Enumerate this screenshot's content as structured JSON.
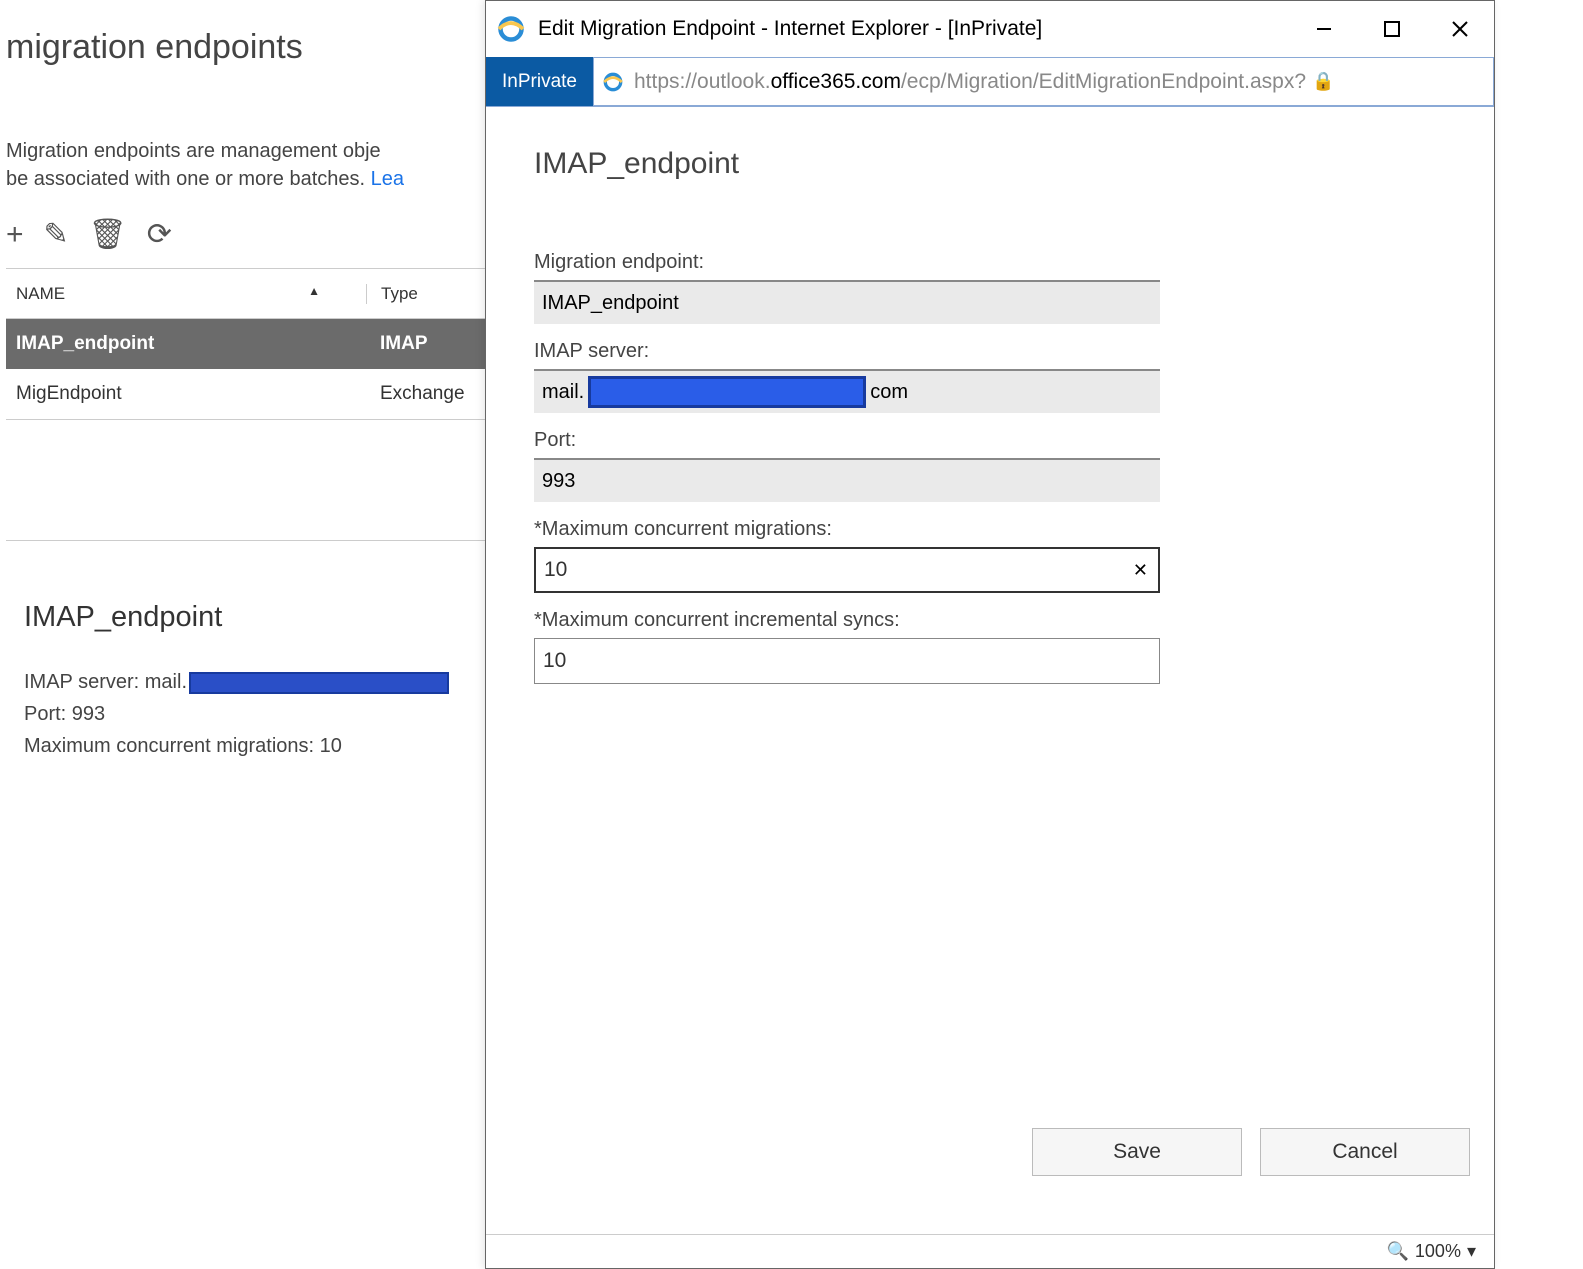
{
  "bg": {
    "title": "migration endpoints",
    "desc_line1": "Migration endpoints are management obje",
    "desc_line2": "be associated with one or more batches. ",
    "learn_link": "Lea",
    "table": {
      "header_name": "NAME",
      "header_type": "Type",
      "rows": [
        {
          "name": "IMAP_endpoint",
          "type": "IMAP",
          "selected": true
        },
        {
          "name": "MigEndpoint",
          "type": "Exchange",
          "selected": false
        }
      ]
    },
    "details": {
      "title": "IMAP_endpoint",
      "imap_label": "IMAP server: mail.",
      "port_line": "Port: 993",
      "max_line": "Maximum concurrent migrations: 10"
    }
  },
  "popup": {
    "window_title": "Edit Migration Endpoint - Internet Explorer - [InPrivate]",
    "inprivate": "InPrivate",
    "url_prefix": "https://outlook.",
    "url_dark": "office365.com",
    "url_suffix": "/ecp/Migration/EditMigrationEndpoint.aspx?",
    "form_title": "IMAP_endpoint",
    "fields": {
      "endpoint_label": "Migration endpoint:",
      "endpoint_value": "IMAP_endpoint",
      "imap_label": "IMAP server:",
      "imap_prefix": "mail.",
      "imap_suffix": "com",
      "port_label": "Port:",
      "port_value": "993",
      "max_mig_label": "*Maximum concurrent migrations:",
      "max_mig_value": "10",
      "max_inc_label": "*Maximum concurrent incremental syncs:",
      "max_inc_value": "10"
    },
    "buttons": {
      "save": "Save",
      "cancel": "Cancel"
    },
    "zoom": "100%"
  }
}
